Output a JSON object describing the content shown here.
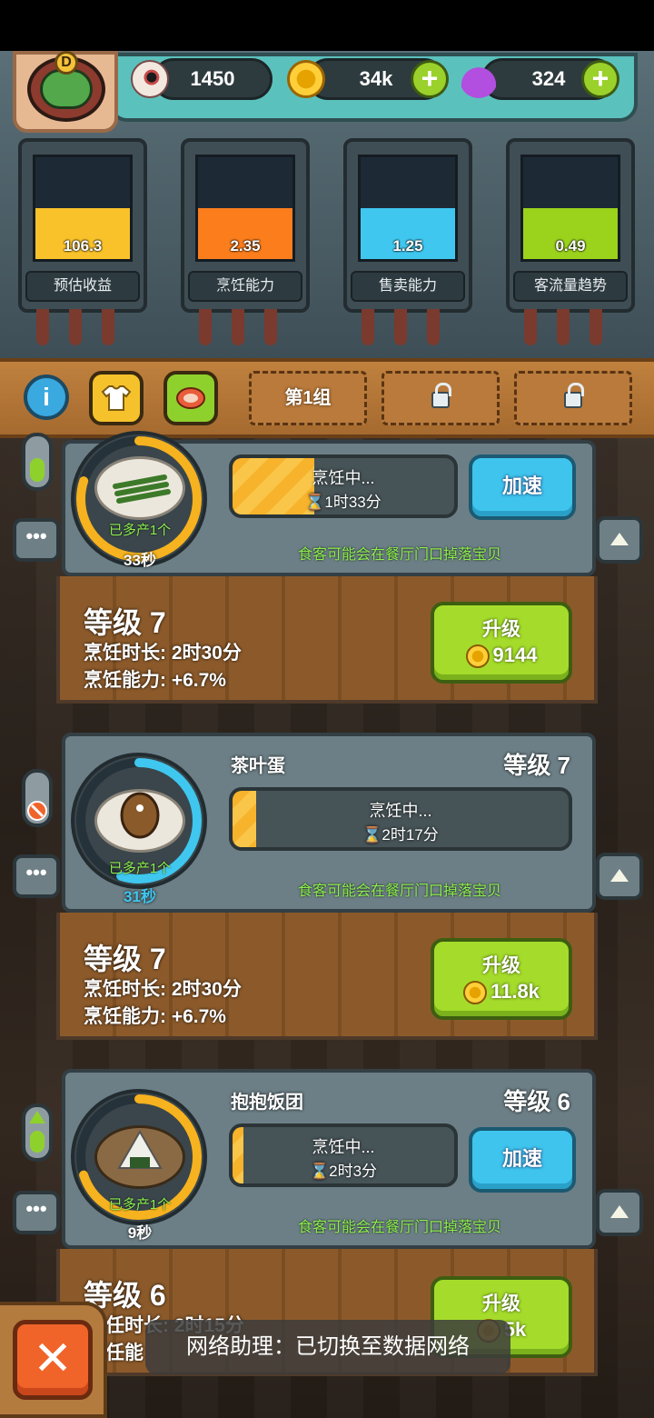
{
  "header": {
    "eyes": "1450",
    "coins": "34k",
    "potions": "324",
    "avatar_badge": "D"
  },
  "stats": [
    {
      "value": "106.3",
      "label": "预估收益",
      "color": "#f9c22a",
      "fill": 0.5
    },
    {
      "value": "2.35",
      "label": "烹饪能力",
      "color": "#fb7d1c",
      "fill": 0.5
    },
    {
      "value": "1.25",
      "label": "售卖能力",
      "color": "#3fc7ef",
      "fill": 0.5
    },
    {
      "value": "0.49",
      "label": "客流量趋势",
      "color": "#9ad21c",
      "fill": 0.5
    }
  ],
  "groups": {
    "group1": "第1组"
  },
  "stations": [
    {
      "name": "",
      "level_badge": "",
      "status": "烹饪中...",
      "remaining": "1时33分",
      "progress": 0.37,
      "ring_progress": 0.8,
      "bonus": "已多产1个",
      "timer": "33秒",
      "speed_label": "加速",
      "drop_text": "食客可能会在餐厅门口掉落宝贝",
      "level": "等级 7",
      "duration": "烹饪时长: 2时30分",
      "ability": "烹饪能力: +6.7%",
      "upgrade_label": "升级",
      "upgrade_cost": "9144"
    },
    {
      "name": "茶叶蛋",
      "level_badge": "等级 7",
      "status": "烹饪中...",
      "remaining": "2时17分",
      "progress": 0.07,
      "ring_progress": 0.55,
      "bonus": "已多产1个",
      "timer": "31秒",
      "drop_text": "食客可能会在餐厅门口掉落宝贝",
      "level": "等级 7",
      "duration": "烹饪时长: 2时30分",
      "ability": "烹饪能力: +6.7%",
      "upgrade_label": "升级",
      "upgrade_cost": "11.8k"
    },
    {
      "name": "抱抱饭团",
      "level_badge": "等级 6",
      "status": "烹饪中...",
      "remaining": "2时3分",
      "progress": 0.05,
      "ring_progress": 0.7,
      "bonus": "已多产1个",
      "timer": "9秒",
      "speed_label": "加速",
      "drop_text": "食客可能会在餐厅门口掉落宝贝",
      "level": "等级 6",
      "duration": "任时长: 2时15分",
      "ability": "任能",
      "upgrade_label": "升级",
      "upgrade_cost": "5k"
    }
  ],
  "toast": "网络助理：已切换至数据网络",
  "colors": {
    "accent_green": "#a5dc2b",
    "accent_blue": "#3fc4ee",
    "close_orange": "#f0642a"
  }
}
